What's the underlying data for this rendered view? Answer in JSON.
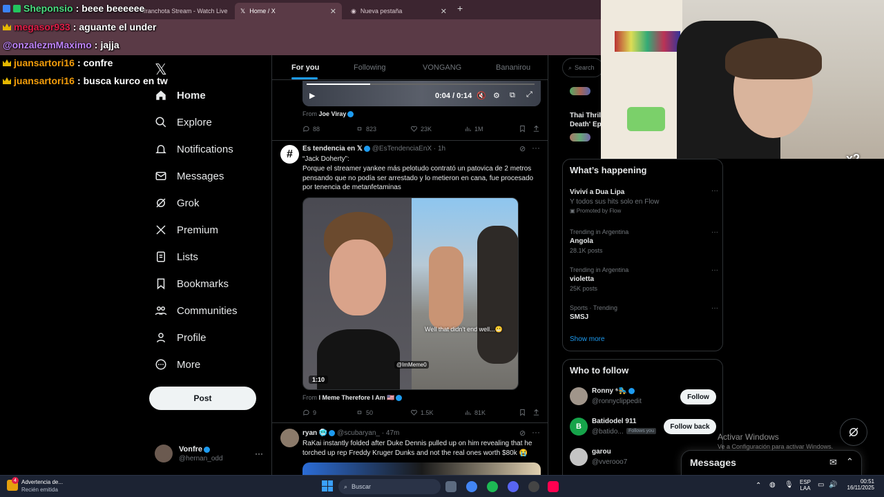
{
  "browser": {
    "tabs": [
      {
        "label": "ffranchota Stream - Watch Live",
        "active": false
      },
      {
        "label": "Home / X",
        "active": true
      },
      {
        "label": "Nueva pestaña",
        "active": false
      }
    ],
    "new_tab": "+"
  },
  "chat_overlay": [
    {
      "user": "Sheponsio",
      "message": "beee beeeeee",
      "color": "#4ade80"
    },
    {
      "user": "megasor933",
      "message": "aguante el under",
      "color": "#e11d48"
    },
    {
      "user": "@onzalezmMaximo",
      "message": "jajja",
      "color": "#c084fc"
    },
    {
      "user": "juansartori16",
      "message": "confre",
      "color": "#f59e0b"
    },
    {
      "user": "juansartori16",
      "message": "busca kurco en tw",
      "color": "#f59e0b"
    }
  ],
  "nav": {
    "items": [
      {
        "label": "Home",
        "icon": "home-icon"
      },
      {
        "label": "Explore",
        "icon": "search-icon"
      },
      {
        "label": "Notifications",
        "icon": "bell-icon"
      },
      {
        "label": "Messages",
        "icon": "envelope-icon"
      },
      {
        "label": "Grok",
        "icon": "grok-icon"
      },
      {
        "label": "Premium",
        "icon": "x-logo-icon"
      },
      {
        "label": "Lists",
        "icon": "list-icon"
      },
      {
        "label": "Bookmarks",
        "icon": "bookmark-icon"
      },
      {
        "label": "Communities",
        "icon": "people-icon"
      },
      {
        "label": "Profile",
        "icon": "person-icon"
      },
      {
        "label": "More",
        "icon": "more-circle-icon"
      }
    ],
    "post_label": "Post",
    "account": {
      "name": "Vonfre",
      "handle": "@hernan_odd"
    }
  },
  "feed": {
    "tabs": [
      "For you",
      "Following",
      "VONGANG",
      "Bananirou"
    ],
    "video": {
      "time": "0:04 / 0:14",
      "from_label": "From",
      "from_name": "Joe Viray"
    },
    "tweet1_actions": {
      "replies": "88",
      "reposts": "823",
      "likes": "23K",
      "views": "1M"
    },
    "tweet2": {
      "name": "Es tendencia en 𝕏",
      "handle": "@EsTendenciaEnX",
      "time": "· 1h",
      "text_line1": "“Jack Doherty”:",
      "text_body": "Porque el streamer yankee más pelotudo contrató un patovica de 2 metros pensando que no podía ser arrestado y lo metieron en cana, fue procesado por tenencia de metanfetaminas",
      "media_caption": "Well that didn't end well...😬",
      "media_watermark": "@ImMeme0",
      "media_duration": "1:10",
      "from_label": "From",
      "from_name": "I Meme Therefore I Am 🇺🇸",
      "replies": "9",
      "reposts": "50",
      "likes": "1.5K",
      "views": "81K"
    },
    "tweet3": {
      "name": "ryan 🥶",
      "handle": "@scubaryan_",
      "time": "· 47m",
      "text": "RaKai instantly folded after Duke Dennis pulled up on him revealing that he torched up rep Freddy Kruger Dunks and not the real ones worth $80k 😭"
    }
  },
  "sidebar": {
    "search_placeholder": "Search",
    "peek_title": "Thai Thrill",
    "peek_title2": "Death' Ep",
    "whats_happening_title": "What’s happening",
    "trends": [
      {
        "meta": "",
        "title": "Viviví a Dua Lipa",
        "sub": "Y todos sus hits solo en Flow",
        "promo": "Promoted by Flow"
      },
      {
        "meta": "Trending in Argentina",
        "title": "Angola",
        "sub": "28.1K posts",
        "promo": ""
      },
      {
        "meta": "Trending in Argentina",
        "title": "violetta",
        "sub": "25K posts",
        "promo": ""
      },
      {
        "meta": "Sports · Trending",
        "title": "SMSJ",
        "sub": "",
        "promo": ""
      }
    ],
    "show_more": "Show more",
    "who_to_follow_title": "Who to follow",
    "suggestions": [
      {
        "name": "Ronny ⁶🛼",
        "handle": "@ronnyclippedit",
        "button": "Follow",
        "follows_you": ""
      },
      {
        "name": "Batidodel 911",
        "handle": "@batido...",
        "button": "Follow back",
        "follows_you": "Follows you"
      },
      {
        "name": "garou",
        "handle": "@vverooo7",
        "button": "",
        "follows_you": ""
      }
    ],
    "messages_title": "Messages"
  },
  "webcam": {
    "multiplier": "x2"
  },
  "windows_activation": {
    "title": "Activar Windows",
    "sub": "Ve a Configuración para activar Windows."
  },
  "taskbar": {
    "notification_title": "Advertencia de...",
    "notification_sub": "Recién emitida",
    "notification_count": "4",
    "search_placeholder": "Buscar",
    "lang": "ESP",
    "lang_sub": "LAA",
    "time": "00:51",
    "date": "16/11/2025"
  }
}
